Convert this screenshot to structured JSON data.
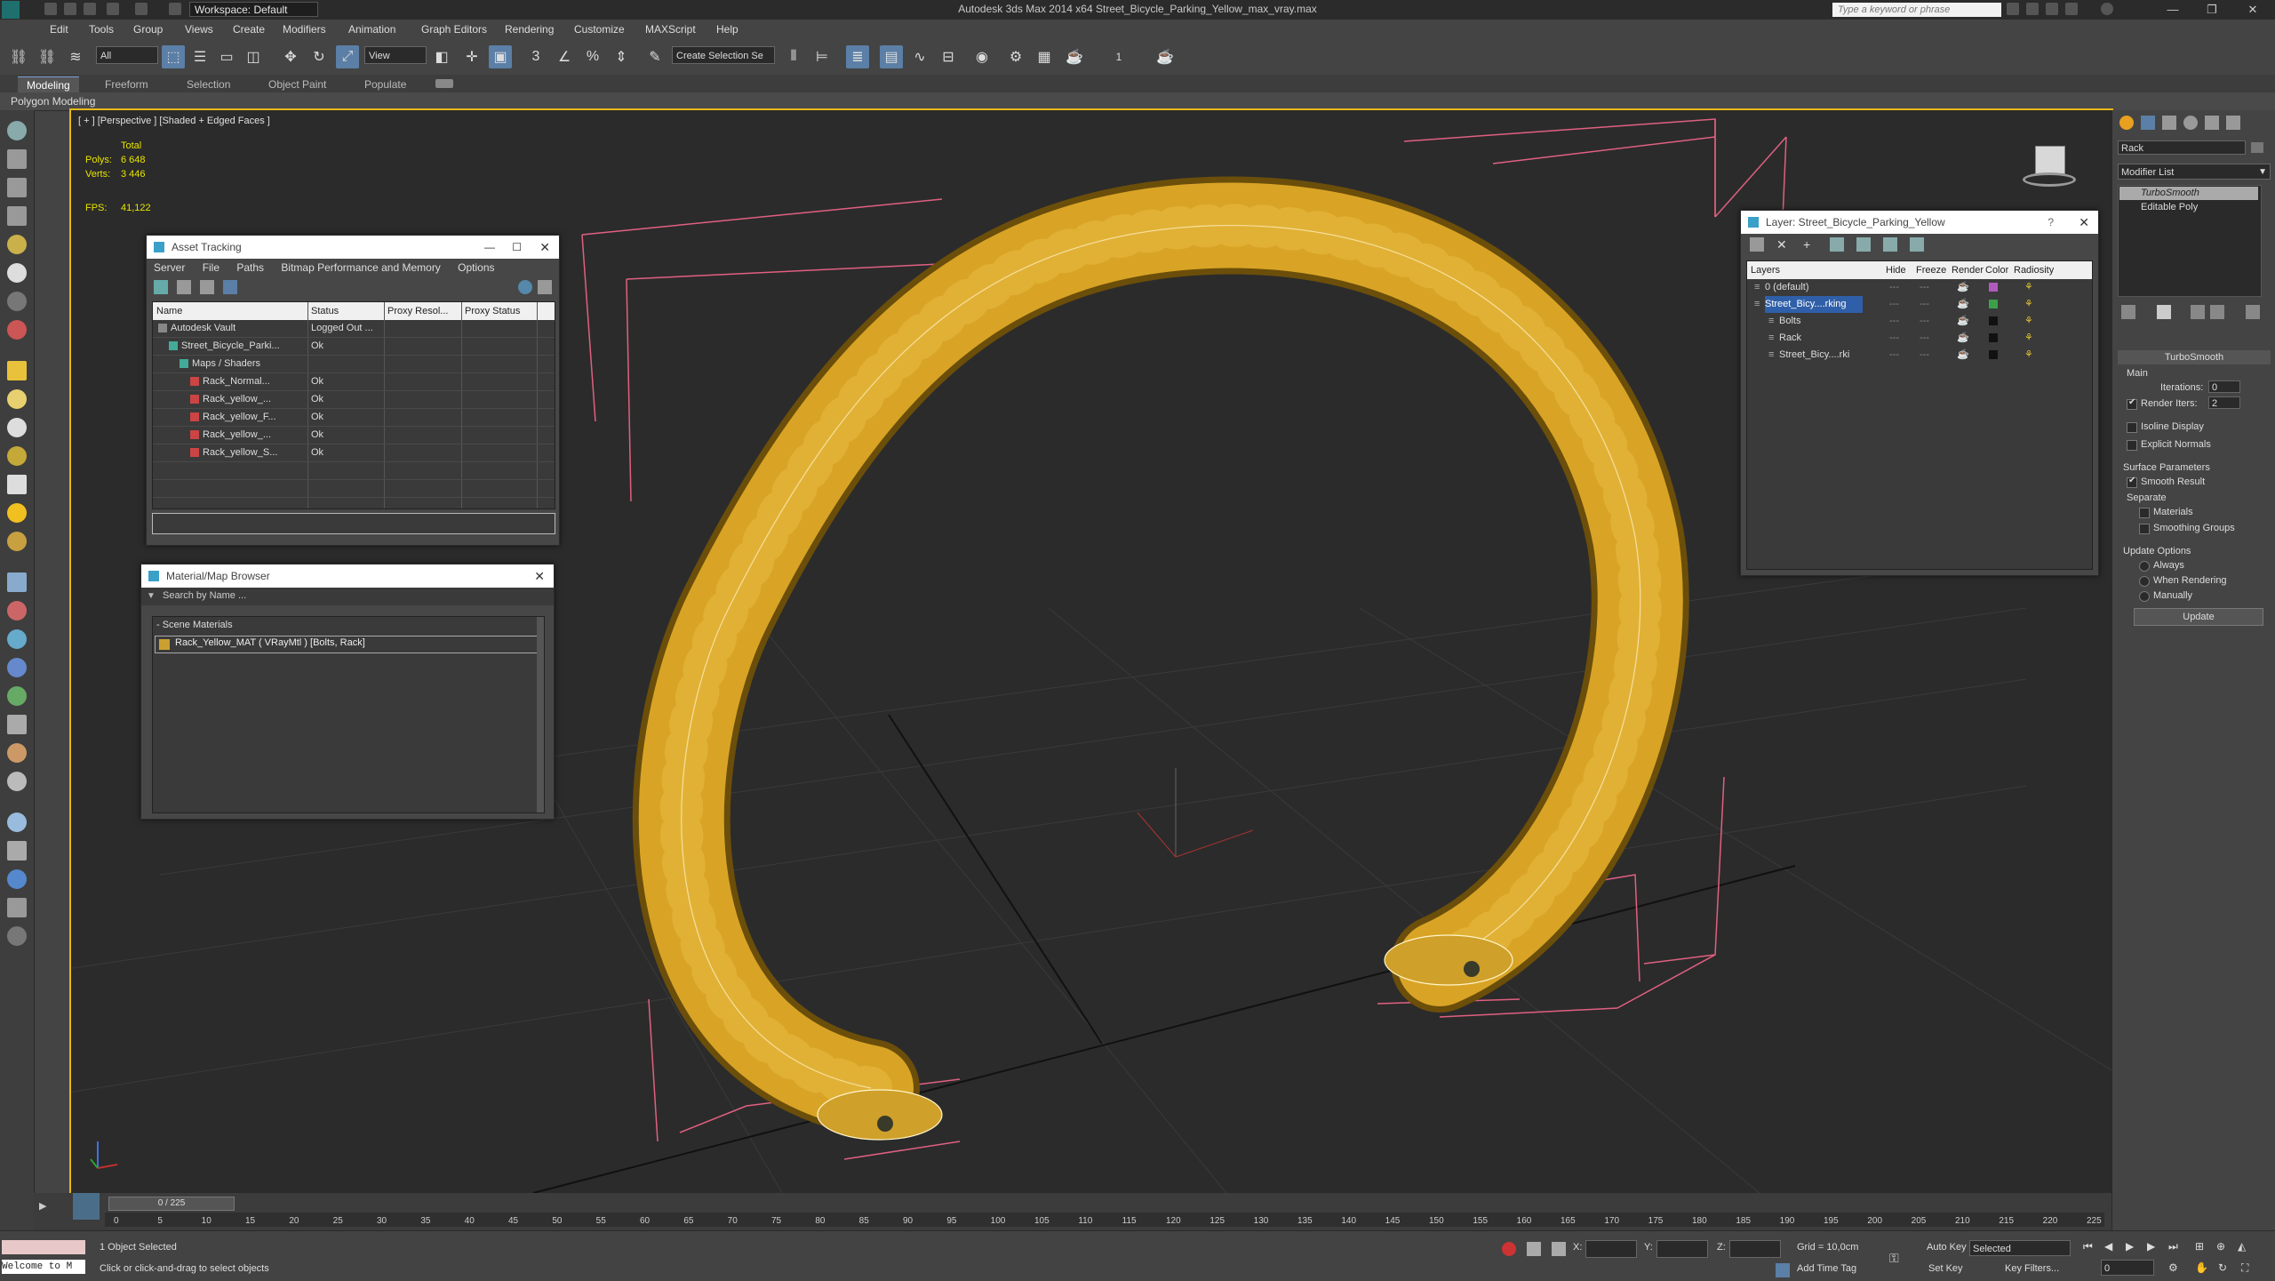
{
  "titlebar": {
    "title": "Autodesk 3ds Max  2014 x64     Street_Bicycle_Parking_Yellow_max_vray.max",
    "workspace": "Workspace: Default",
    "search_placeholder": "Type a keyword or phrase"
  },
  "menu": [
    "Edit",
    "Tools",
    "Group",
    "Views",
    "Create",
    "Modifiers",
    "Animation",
    "Graph Editors",
    "Rendering",
    "Customize",
    "MAXScript",
    "Help"
  ],
  "toolbar": {
    "selection_filter": "All",
    "ref_coord": "View",
    "named_selection": "Create Selection Se",
    "spinner_snap": "1"
  },
  "ribbon": {
    "tabs": [
      "Modeling",
      "Freeform",
      "Selection",
      "Object Paint",
      "Populate"
    ],
    "active": "Modeling",
    "sub_label": "Polygon Modeling"
  },
  "viewport": {
    "label": "[ + ] [Perspective ] [Shaded + Edged Faces ]",
    "stats": {
      "total_label": "Total",
      "polys_label": "Polys:",
      "polys_value": "6 648",
      "verts_label": "Verts:",
      "verts_value": "3 446",
      "fps_label": "FPS:",
      "fps_value": "41,122"
    }
  },
  "asset_tracking": {
    "title": "Asset Tracking",
    "menu": [
      "Server",
      "File",
      "Paths",
      "Bitmap Performance and Memory",
      "Options"
    ],
    "columns": [
      "Name",
      "Status",
      "Proxy Resol...",
      "Proxy Status"
    ],
    "rows": [
      {
        "name": "Autodesk Vault",
        "status": "Logged Out ...",
        "indent": 0
      },
      {
        "name": "Street_Bicycle_Parki...",
        "status": "Ok",
        "indent": 1
      },
      {
        "name": "Maps / Shaders",
        "status": "",
        "indent": 2
      },
      {
        "name": "Rack_Normal...",
        "status": "Ok",
        "indent": 3
      },
      {
        "name": "Rack_yellow_...",
        "status": "Ok",
        "indent": 3
      },
      {
        "name": "Rack_yellow_F...",
        "status": "Ok",
        "indent": 3
      },
      {
        "name": "Rack_yellow_...",
        "status": "Ok",
        "indent": 3
      },
      {
        "name": "Rack_yellow_S...",
        "status": "Ok",
        "indent": 3
      }
    ]
  },
  "material_browser": {
    "title": "Material/Map Browser",
    "search_placeholder": "Search by Name ...",
    "group": "- Scene Materials",
    "item": "Rack_Yellow_MAT  ( VRayMtl ) [Bolts, Rack]"
  },
  "layer_window": {
    "title": "Layer: Street_Bicycle_Parking_Yellow",
    "columns": [
      "Layers",
      "Hide",
      "Freeze",
      "Render",
      "Color",
      "Radiosity"
    ],
    "rows": [
      {
        "name": "0 (default)",
        "indent": 0,
        "color": "#b05ac0",
        "selected": false
      },
      {
        "name": "Street_Bicy....rking",
        "indent": 0,
        "color": "#3aa04a",
        "selected": true
      },
      {
        "name": "Bolts",
        "indent": 1,
        "color": "#111111",
        "selected": false
      },
      {
        "name": "Rack",
        "indent": 1,
        "color": "#111111",
        "selected": false
      },
      {
        "name": "Street_Bicy....rki",
        "indent": 1,
        "color": "#111111",
        "selected": false
      }
    ]
  },
  "command_panel": {
    "object_name": "Rack",
    "modifier_list": "Modifier List",
    "stack": [
      "TurboSmooth",
      "Editable Poly"
    ],
    "rollout_title": "TurboSmooth",
    "main_label": "Main",
    "iterations_label": "Iterations:",
    "iterations_value": "0",
    "render_iters_label": "Render Iters:",
    "render_iters_value": "2",
    "isoline": "Isoline Display",
    "explicit": "Explicit Normals",
    "surface_params": "Surface Parameters",
    "smooth_result": "Smooth Result",
    "separate": "Separate",
    "materials": "Materials",
    "smoothing_groups": "Smoothing Groups",
    "update_options": "Update Options",
    "always": "Always",
    "when_rendering": "When Rendering",
    "manually": "Manually",
    "update_btn": "Update"
  },
  "timeline": {
    "frame_display": "0 / 225",
    "ticks": [
      "0",
      "5",
      "10",
      "15",
      "20",
      "25",
      "30",
      "35",
      "40",
      "45",
      "50",
      "55",
      "60",
      "65",
      "70",
      "75",
      "80",
      "85",
      "90",
      "95",
      "100",
      "105",
      "110",
      "115",
      "120",
      "125",
      "130",
      "135",
      "140",
      "145",
      "150",
      "155",
      "160",
      "165",
      "170",
      "175",
      "180",
      "185",
      "190",
      "195",
      "200",
      "205",
      "210",
      "215",
      "220",
      "225"
    ]
  },
  "statusbar": {
    "maxscript": "Welcome to M",
    "selected": "1 Object Selected",
    "prompt": "Click or click-and-drag to select objects",
    "x_label": "X:",
    "y_label": "Y:",
    "z_label": "Z:",
    "grid": "Grid = 10,0cm",
    "add_time_tag": "Add Time Tag",
    "auto_key": "Auto Key",
    "set_key": "Set Key",
    "selected_dd": "Selected",
    "key_filters": "Key Filters...",
    "frame": "0"
  }
}
